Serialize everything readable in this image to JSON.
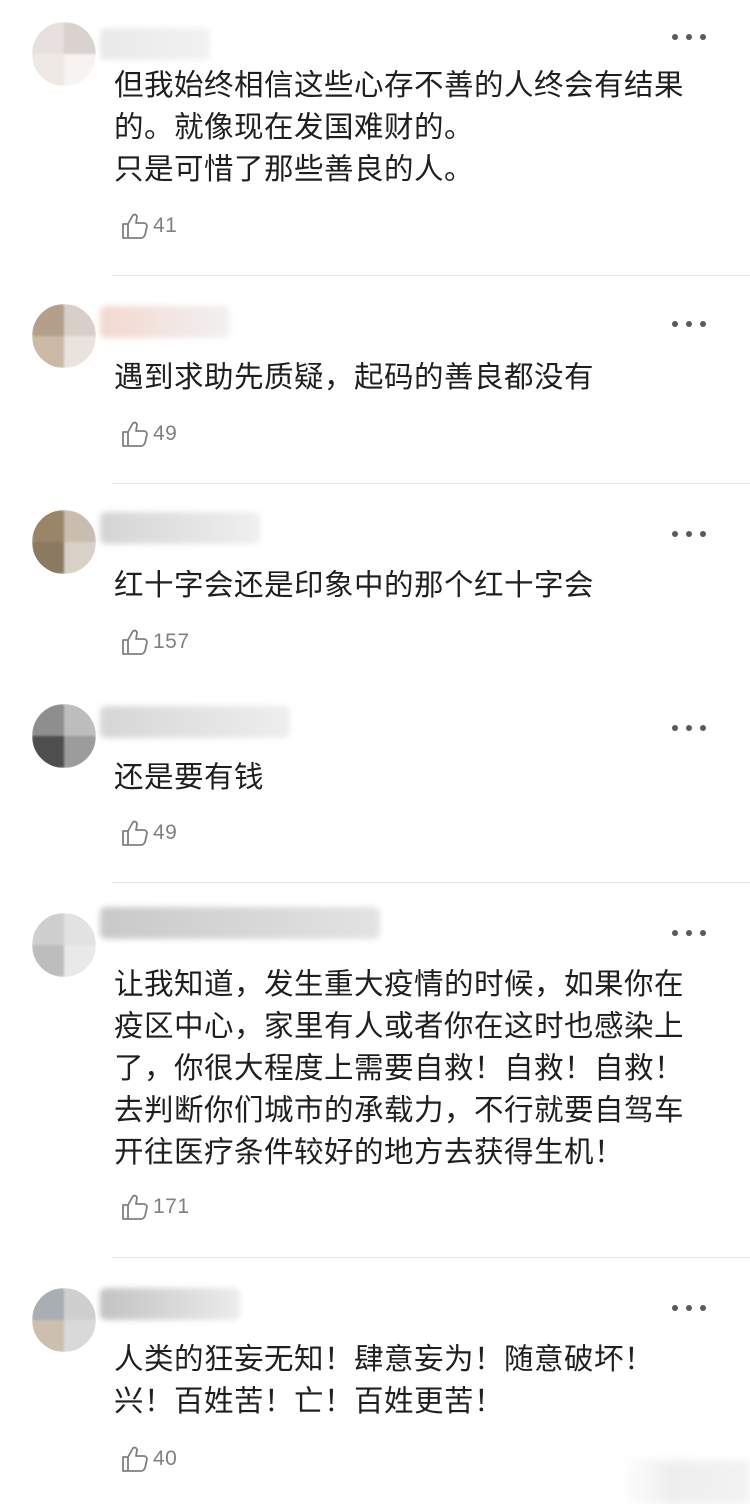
{
  "comments": [
    {
      "text": "但我始终相信这些心存不善的人终会有结果\n的。就像现在发国难财的。\n只是可惜了那些善良的人。",
      "likes": "41",
      "avatar_colors": [
        "#e8e0df",
        "#d9d2cf",
        "#efe9e6",
        "#f6f3f1"
      ],
      "username_colors": [
        "#e9e9e9",
        "#f2f2f2"
      ]
    },
    {
      "text": "遇到求助先质疑，起码的善良都没有",
      "likes": "49",
      "avatar_colors": [
        "#b39f8a",
        "#d8cfc8",
        "#c9b9a5",
        "#e9e3dd"
      ],
      "username_colors": [
        "#f3d8cf",
        "#f1f1f1"
      ]
    },
    {
      "text": "红十字会还是印象中的那个红十字会",
      "likes": "157",
      "avatar_colors": [
        "#9a8568",
        "#c9bdb0",
        "#8a7a62",
        "#d8d1c8"
      ],
      "username_colors": [
        "#d4d4d4",
        "#efefef"
      ]
    },
    {
      "text": "还是要有钱",
      "likes": "49",
      "avatar_colors": [
        "#8e8e8e",
        "#bdbdbd",
        "#4e4e4e",
        "#9c9c9c"
      ],
      "username_colors": [
        "#d6d6d6",
        "#eeeeee"
      ]
    },
    {
      "text": "让我知道，发生重大疫情的时候，如果你在\n疫区中心，家里有人或者你在这时也感染上\n了，你很大程度上需要自救！自救！自救！\n去判断你们城市的承载力，不行就要自驾车\n开往医疗条件较好的地方去获得生机！",
      "likes": "171",
      "avatar_colors": [
        "#cfcfcf",
        "#e2e2e2",
        "#bdbdbd",
        "#e9e9e9"
      ],
      "username_colors": [
        "#c9c9c9",
        "#e3e3e3"
      ]
    },
    {
      "text": "人类的狂妄无知！肆意妄为！随意破坏！\n兴！百姓苦！亡！百姓更苦！",
      "likes": "40",
      "avatar_colors": [
        "#a9aeb3",
        "#cfcfcf",
        "#cdbfae",
        "#d9d9d9"
      ],
      "username_colors": [
        "#c2c2c2",
        "#ececec"
      ]
    }
  ],
  "icons": {
    "like": "thumbs-up-icon",
    "more": "more-dots-icon"
  }
}
